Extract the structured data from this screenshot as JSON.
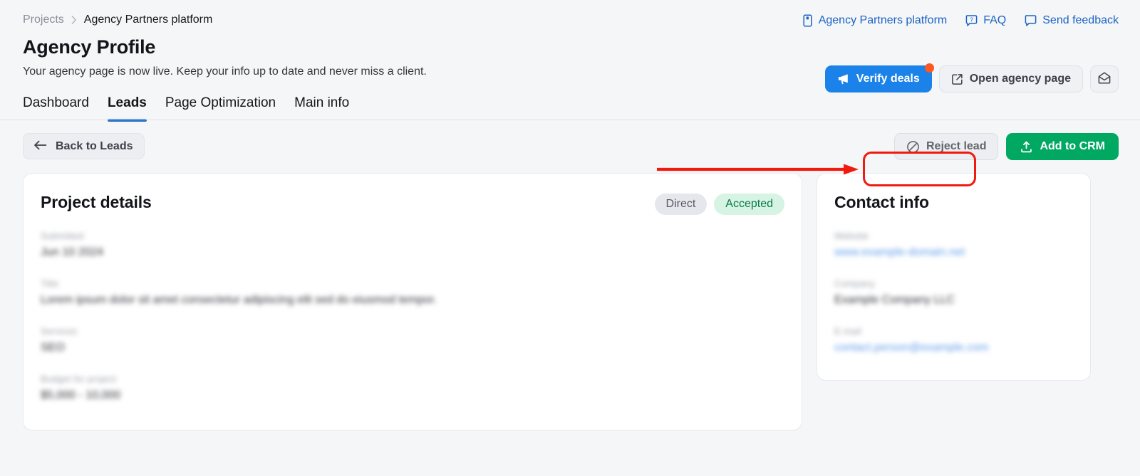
{
  "breadcrumb": {
    "root": "Projects",
    "separator": "›",
    "current": "Agency Partners platform"
  },
  "header": {
    "title": "Agency Profile",
    "subtitle": "Your agency page is now live. Keep your info up to date and never miss a client.",
    "links": [
      {
        "label": "Agency Partners platform",
        "icon": "book-icon"
      },
      {
        "label": "FAQ",
        "icon": "faq-bubble-icon"
      },
      {
        "label": "Send feedback",
        "icon": "feedback-bubble-icon"
      }
    ],
    "actions": {
      "verify_deals": "Verify deals",
      "verify_deals_icon": "megaphone-icon",
      "verify_deals_has_badge": true,
      "open_agency_page": "Open agency page",
      "open_agency_page_icon": "external-link-icon",
      "mail_icon": "open-envelope-icon"
    }
  },
  "tabs": [
    {
      "label": "Dashboard",
      "active": false
    },
    {
      "label": "Leads",
      "active": true
    },
    {
      "label": "Page Optimization",
      "active": false
    },
    {
      "label": "Main info",
      "active": false
    }
  ],
  "actionbar": {
    "back": "Back to Leads",
    "back_icon": "arrow-left-icon",
    "reject": "Reject lead",
    "reject_icon": "ban-circle-icon",
    "add_to_crm": "Add to CRM",
    "add_to_crm_icon": "upload-icon"
  },
  "annotation": {
    "type": "arrow-pointing-right",
    "color": "#f01a0e",
    "target": "Reject lead"
  },
  "project_details": {
    "title": "Project details",
    "badges": [
      {
        "label": "Direct",
        "style": "neutral"
      },
      {
        "label": "Accepted",
        "style": "success"
      }
    ],
    "fields": [
      {
        "label": "Submitted",
        "value": "Jun 10 2024",
        "redacted": true
      },
      {
        "label": "Title",
        "value": "Lorem ipsum dolor sit amet consectetur adipiscing elit sed do eiusmod tempor.",
        "redacted": true
      },
      {
        "label": "Services",
        "value": "SEO",
        "redacted": true
      },
      {
        "label": "Budget for project",
        "value": "$5,000 - 10,000",
        "redacted": true
      }
    ]
  },
  "contact_info": {
    "title": "Contact info",
    "fields": [
      {
        "label": "Website",
        "value": "www.example-domain.net",
        "redacted": true,
        "link": true
      },
      {
        "label": "Company",
        "value": "Example Company LLC",
        "redacted": true,
        "link": false
      },
      {
        "label": "E-mail",
        "value": "contact.person@example.com",
        "redacted": true,
        "link": true
      }
    ]
  },
  "colors": {
    "page_background": "#f5f6f8",
    "accent_blue": "#1a82e8",
    "link_blue": "#1b63c4",
    "tab_active_underline": "#1367c8",
    "crm_green": "#00a862",
    "annotation_red": "#f01a0e",
    "badge_success_bg": "#d6f3e4",
    "badge_neutral_bg": "#e6e7ec"
  }
}
